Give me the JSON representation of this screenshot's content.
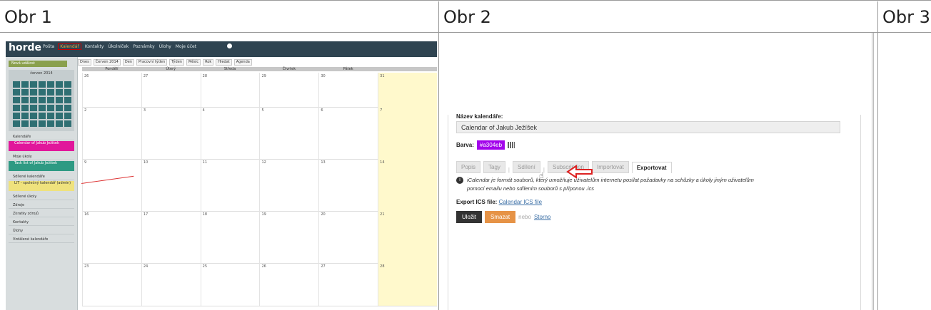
{
  "headers": [
    "Obr 1",
    "Obr 2",
    "Obr 3"
  ],
  "obr1": {
    "app_logo": "horde",
    "top_nav": [
      "Pošta",
      "Kalendář",
      "Kontakty",
      "Úkolníček",
      "Poznámky",
      "Úlohy",
      "Moje účet"
    ],
    "active_nav": "Kalendář",
    "new_event": "Nová událost",
    "mini_cal_title": "červen 2014",
    "sidebar_sections": [
      "Kalendáře",
      "Moje úkoly",
      "Sdílené kalendáře",
      "Sdílené úkoly",
      "Zdroje",
      "Zkratky zdrojů",
      "Kontakty",
      "Úlohy",
      "Vzdálené kalendáře"
    ],
    "sidebar_cals": [
      "Calendar of Jakub Ježíšek",
      "Task list of Jakub Ježíšek",
      "LIT - společný kalendář (admin)"
    ],
    "toolbar": [
      "Dnes",
      "Červen 2014",
      "Den",
      "Pracovní týden",
      "Týden",
      "Měsíc",
      "Rok",
      "Hledat",
      "Agenda"
    ],
    "day_headers": [
      "Pondělí",
      "Úterý",
      "Středa",
      "Čtvrtek",
      "Pátek"
    ],
    "weeks": [
      [
        "26",
        "27",
        "28",
        "29",
        "30",
        "31"
      ],
      [
        "2",
        "3",
        "4",
        "5",
        "6",
        "7"
      ],
      [
        "9",
        "10",
        "11",
        "12",
        "13",
        "14"
      ],
      [
        "16",
        "17",
        "18",
        "19",
        "20",
        "21"
      ],
      [
        "23",
        "24",
        "25",
        "26",
        "27",
        "28"
      ]
    ]
  },
  "obr2": {
    "name_label": "Název kalendáře:",
    "name_value": "Calendar of Jakub Ježíšek",
    "color_label": "Barva:",
    "color_value": "#a304eb",
    "tabs": [
      "Popis",
      "Tagy",
      "Sdílení",
      "Subscription",
      "Importovat",
      "Exportovat"
    ],
    "active_tab": "Exportovat",
    "info_line1": "iCalendar je formát souborů, který umožňuje uživatelům internetu posílat požadavky na schůzky a úkoly jiným uživatelům",
    "info_line2": "pomocí emailu nebo sdílením souborů s příponou .ics",
    "export_label": "Export ICS file:",
    "export_link": "Calendar ICS file",
    "save": "Uložit",
    "delete": "Smazat",
    "or": "nebo",
    "back": "Storno"
  },
  "colors": {
    "accent_red": "#cc2222",
    "swatch": "#a304eb",
    "delete_btn": "#e69346"
  }
}
